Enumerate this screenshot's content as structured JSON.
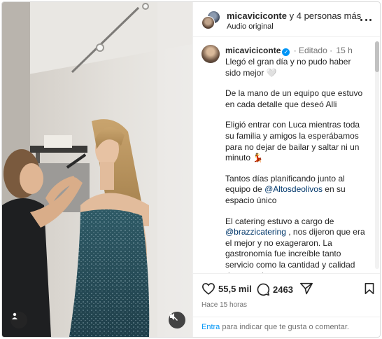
{
  "header": {
    "username": "micaviciconte",
    "connector": " y 4 personas más",
    "subtitle": "Audio original"
  },
  "caption": {
    "username": "micaviciconte",
    "edited": "· Editado ·",
    "time_ago": "15 h",
    "p1": "Llegó el gran día y no pudo haber sido mejor 🤍",
    "p2": "De la mano de un equipo que estuvo en cada detalle que deseó Alli",
    "p3": "Eligió entrar con Luca mientras toda su familia y amigos la esperábamos para no dejar de bailar y saltar ni un minuto 💃",
    "p4_before": "Tantos días planificando junto al equipo de ",
    "p4_mention": "@Altosdeolivos",
    "p4_after": " en su espacio único",
    "p5_before": "El catering estuvo a cargo de ",
    "p5_mention": "@brazzicatering",
    "p5_after": " , nos dijeron que era el mejor y no exageraron. La gastronomía fue increíble tanto servicio como la cantidad y calidad de casa plato."
  },
  "actions": {
    "likes": "55,5 mil",
    "comments": "2463",
    "posted": "Hace 15 horas"
  },
  "comment_bar": {
    "link": "Entra",
    "rest": " para indicar que te gusta o comentar."
  },
  "icons": {
    "like": "heart-icon",
    "comment": "comment-bubble-icon",
    "share": "paper-plane-icon",
    "save": "bookmark-icon",
    "more": "more-options-icon",
    "tags": "user-tag-icon",
    "mute": "muted-speaker-icon"
  },
  "colors": {
    "accent": "#0095f6",
    "mention": "#00376b",
    "muted_text": "#737373"
  }
}
